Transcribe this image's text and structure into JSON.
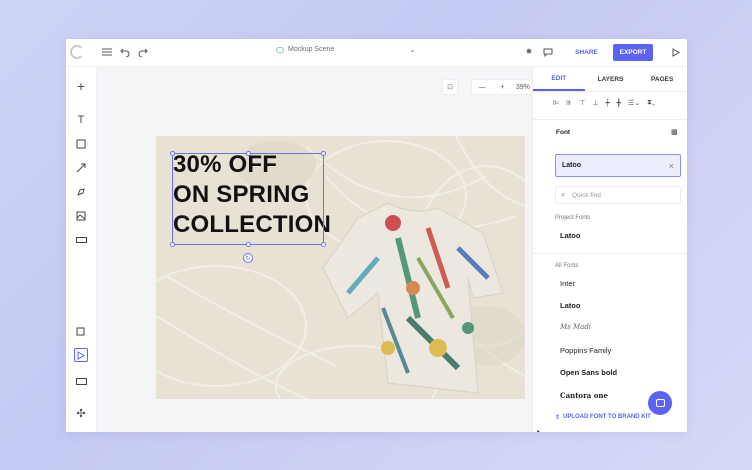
{
  "toolbar": {
    "scene_name": "Mockup Scene",
    "share_label": "SHARE",
    "export_label": "EXPORT"
  },
  "canvas": {
    "zoom_level": "39%",
    "headline_lines": [
      "30% OFF",
      "ON SPRING",
      "COLLECTION"
    ]
  },
  "panel": {
    "tabs": [
      "EDIT",
      "LAYERS",
      "PAGES"
    ],
    "font_section_label": "Font",
    "selected_font": "Latoo",
    "search_placeholder": "Quick find",
    "project_fonts_label": "Project Fonts",
    "project_fonts": [
      "Latoo"
    ],
    "all_fonts_label": "All Fonts",
    "all_fonts": [
      "Inter",
      "Latoo",
      "Ms Madi",
      "Poppins Family",
      "Open Sans bold",
      "Cantora one"
    ],
    "upload_label": "UPLOAD FONT TO BRAND KIT"
  },
  "colors": {
    "accent": "#5b63f3",
    "background": "#c8cdf4",
    "artboard": "#e7e2d3"
  },
  "icons": {
    "logo": "g-logo-icon",
    "menu": "hamburger-icon",
    "undo": "undo-icon",
    "redo": "redo-icon",
    "comment": "comment-icon",
    "play": "play-icon"
  }
}
